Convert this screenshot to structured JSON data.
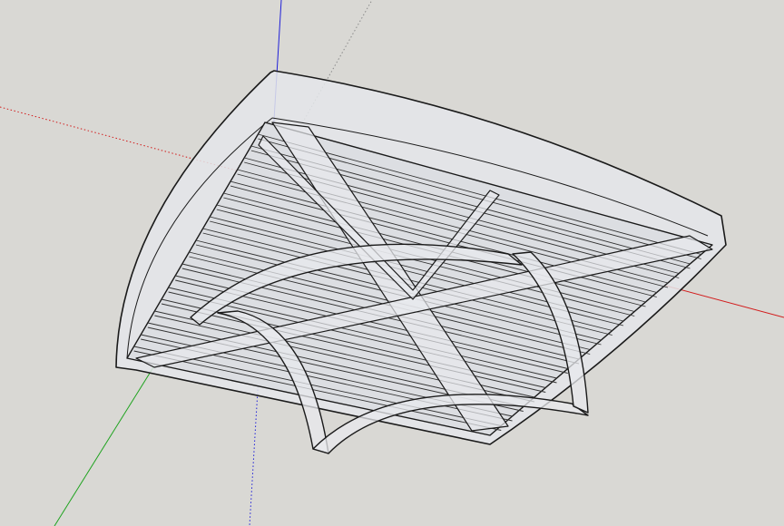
{
  "viewport": {
    "background": "#d9d8d4",
    "axis_colors": {
      "red": "#d21c1c",
      "green": "#1fa31f",
      "blue": "#2020d8",
      "dotted_guide": "#8a8a8a"
    },
    "model": {
      "fill": "#e4e6ea",
      "edge": "#1a1a1a",
      "slat_count": 20
    }
  }
}
